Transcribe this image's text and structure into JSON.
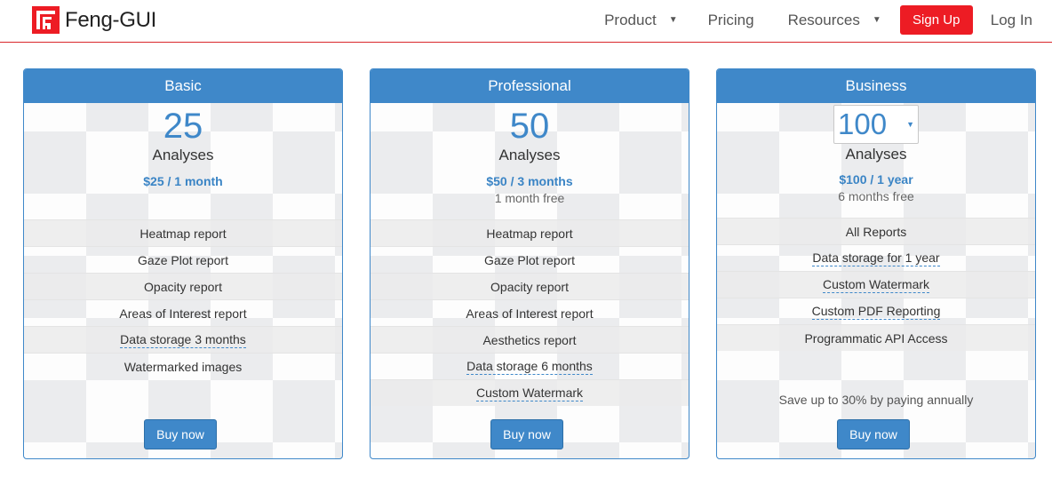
{
  "header": {
    "brand": "Feng-GUI",
    "nav": {
      "product": "Product",
      "pricing": "Pricing",
      "resources": "Resources",
      "signup": "Sign Up",
      "login": "Log In"
    },
    "accent_color": "#ed1c24"
  },
  "plans": [
    {
      "name": "Basic",
      "count": "25",
      "unit": "Analyses",
      "price": "$25 / 1 month",
      "free": "",
      "features": [
        "Heatmap report",
        "Gaze Plot report",
        "Opacity report",
        "Areas of Interest report",
        "Data storage 3 months",
        "Watermarked images"
      ],
      "buy_label": "Buy now"
    },
    {
      "name": "Professional",
      "count": "50",
      "unit": "Analyses",
      "price": "$50 / 3 months",
      "free": "1 month free",
      "features": [
        "Heatmap report",
        "Gaze Plot report",
        "Opacity report",
        "Areas of Interest report",
        "Aesthetics report",
        "Data storage 6 months",
        "Custom Watermark"
      ],
      "buy_label": "Buy now"
    },
    {
      "name": "Business",
      "count": "100",
      "unit": "Analyses",
      "price": "$100 / 1 year",
      "free": "6 months free",
      "features": [
        "All Reports",
        "Data storage for 1 year",
        "Custom Watermark",
        "Custom PDF Reporting",
        "Programmatic API Access"
      ],
      "note": "Save up to 30% by paying annually",
      "buy_label": "Buy now"
    }
  ],
  "plan_color": "#3f88c9"
}
